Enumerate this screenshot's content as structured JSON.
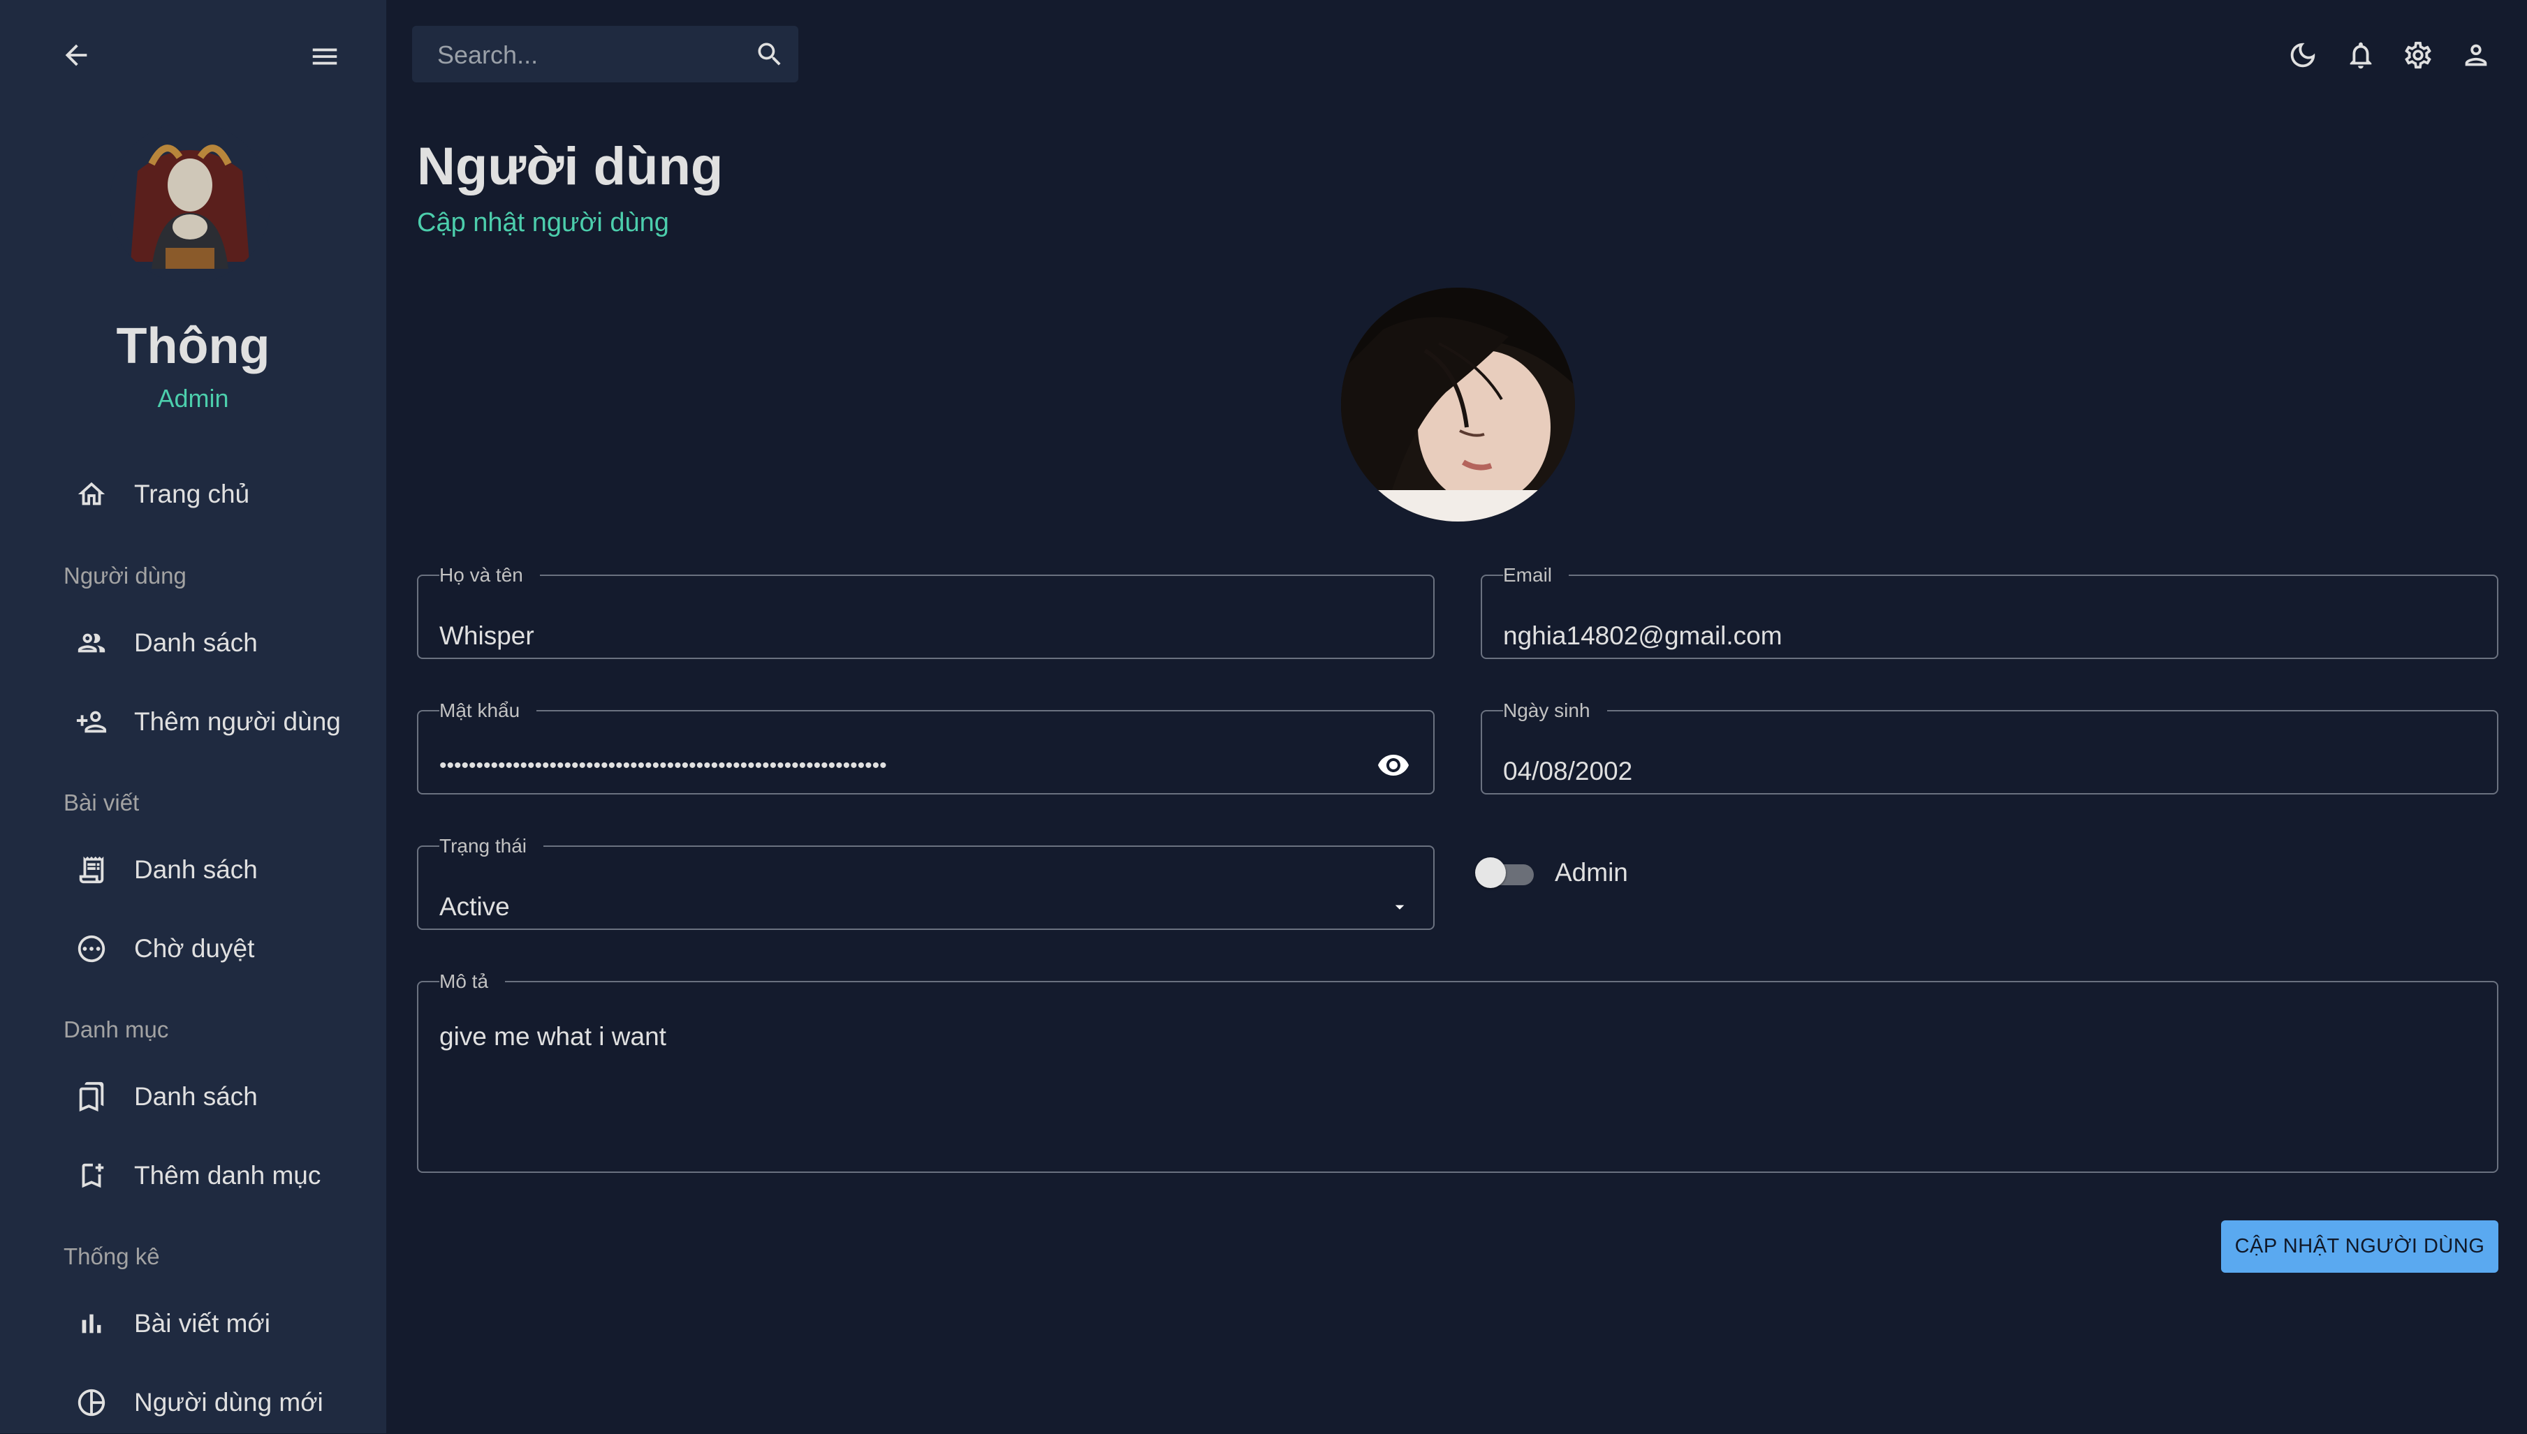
{
  "sidebar": {
    "name": "Thông",
    "role": "Admin",
    "home_label": "Trang chủ",
    "sections": [
      {
        "title": "Người dùng",
        "items": [
          {
            "label": "Danh sách",
            "icon": "users-icon"
          },
          {
            "label": "Thêm người dùng",
            "icon": "add-user-icon"
          }
        ]
      },
      {
        "title": "Bài viết",
        "items": [
          {
            "label": "Danh sách",
            "icon": "receipt-icon"
          },
          {
            "label": "Chờ duyệt",
            "icon": "pending-icon"
          }
        ]
      },
      {
        "title": "Danh mục",
        "items": [
          {
            "label": "Danh sách",
            "icon": "bookmarks-icon"
          },
          {
            "label": "Thêm danh mục",
            "icon": "bookmark-add-icon"
          }
        ]
      },
      {
        "title": "Thống kê",
        "items": [
          {
            "label": "Bài viết mới",
            "icon": "bar-chart-icon"
          },
          {
            "label": "Người dùng mới",
            "icon": "pie-chart-icon"
          }
        ]
      }
    ]
  },
  "topbar": {
    "search_placeholder": "Search...",
    "icons": [
      "moon-icon",
      "bell-icon",
      "gear-icon",
      "person-icon"
    ]
  },
  "page": {
    "title": "Người dùng",
    "subtitle": "Cập nhật người dùng"
  },
  "form": {
    "fullname": {
      "label": "Họ và tên",
      "value": "Whisper"
    },
    "email": {
      "label": "Email",
      "value": "nghia14802@gmail.com"
    },
    "password": {
      "label": "Mật khẩu",
      "value": "•••••••••••••••••••••••••••••••••••••••••••••••••••••••••••••"
    },
    "birthday": {
      "label": "Ngày sinh",
      "value": "04/08/2002"
    },
    "status": {
      "label": "Trạng thái",
      "value": "Active"
    },
    "admin": {
      "label": "Admin",
      "checked": false
    },
    "description": {
      "label": "Mô tả",
      "value": "give me what i want"
    },
    "submit_label": "CẬP NHẬT NGƯỜI DÙNG"
  },
  "colors": {
    "background": "#141b2d",
    "sidebar": "#1f2a40",
    "accent_green": "#4cceac",
    "button_blue": "#5aa9f0"
  }
}
